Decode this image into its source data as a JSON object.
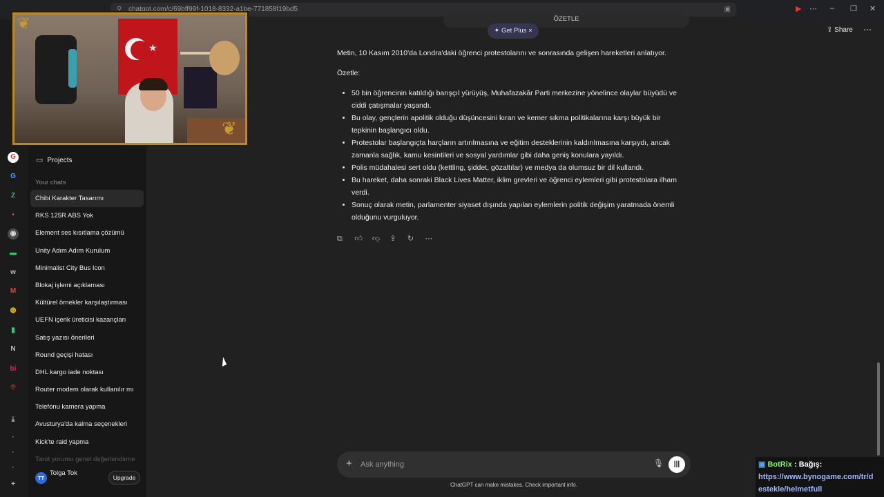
{
  "browser": {
    "url": "chatgpt.com/c/69bff99f-1018-8332-a1be-771858f19bd5"
  },
  "sidebar": {
    "projects_label": "Projects",
    "section_heading": "Your chats",
    "chats": [
      "Chibi Karakter Tasarımı",
      "RKS 125R ABS Yok",
      "Element ses kısıtlama çözümü",
      "Unity Adım Adım Kurulum",
      "Minimalist City Bus Icon",
      "Blokaj işlemi açıklaması",
      "Kültürel örnekler karşılaştırması",
      "UEFN içerik üreticisi kazançları",
      "Satış yazısı önerileri",
      "Round geçişi hatası",
      "DHL kargo iade noktası",
      "Router modem olarak kullanılır mı",
      "Telefonu kamera yapma",
      "Avusturya'da kalma seçenekleri",
      "Kick'te raid yapma",
      "Tarot yorumu genel değerlendirme"
    ],
    "user": {
      "initials": "TT",
      "name": "Tolga Tok",
      "upgrade_label": "Upgrade"
    }
  },
  "header": {
    "top_pill_text": "ÖZETLE",
    "get_plus_label": "Get Plus",
    "share_label": "Share"
  },
  "answer": {
    "intro": "Metin, 10 Kasım 2010'da Londra'daki öğrenci protestolarını ve sonrasında gelişen hareketleri anlatıyor.",
    "summary_label": "Özetle:",
    "bullets": [
      "50 bin öğrencinin katıldığı barışçıl yürüyüş, Muhafazakâr Parti merkezine yönelince olaylar büyüdü ve ciddi çatışmalar yaşandı.",
      "Bu olay, gençlerin apolitik olduğu düşüncesini kıran ve kemer sıkma politikalarına karşı büyük bir tepkinin başlangıcı oldu.",
      "Protestolar başlangıçta harçların artırılmasına ve eğitim desteklerinin kaldırılmasına karşıydı, ancak zamanla sağlık, kamu kesintileri ve sosyal yardımlar gibi daha geniş konulara yayıldı.",
      "Polis müdahalesi sert oldu (kettling, şiddet, gözaltılar) ve medya da olumsuz bir dil kullandı.",
      "Bu hareket, daha sonraki Black Lives Matter, iklim grevleri ve öğrenci eylemleri gibi protestolara ilham verdi.",
      "Sonuç olarak metin, parlamenter siyaset dışında yapılan eylemlerin politik değişim yaratmada önemli olduğunu vurguluyor."
    ]
  },
  "composer": {
    "placeholder": "Ask anything",
    "disclaimer": "ChatGPT can make mistakes. Check important info."
  },
  "overlay": {
    "bot_name": "BotRix",
    "label": ": Bağış:",
    "link_line1": "https://www.bynogame.com/tr/d",
    "link_line2": "estekle/helmetfull"
  },
  "colors": {
    "background": "#212121",
    "sidebar": "#171717",
    "accent_green": "#7cf56b",
    "flag_red": "#c0151b"
  }
}
